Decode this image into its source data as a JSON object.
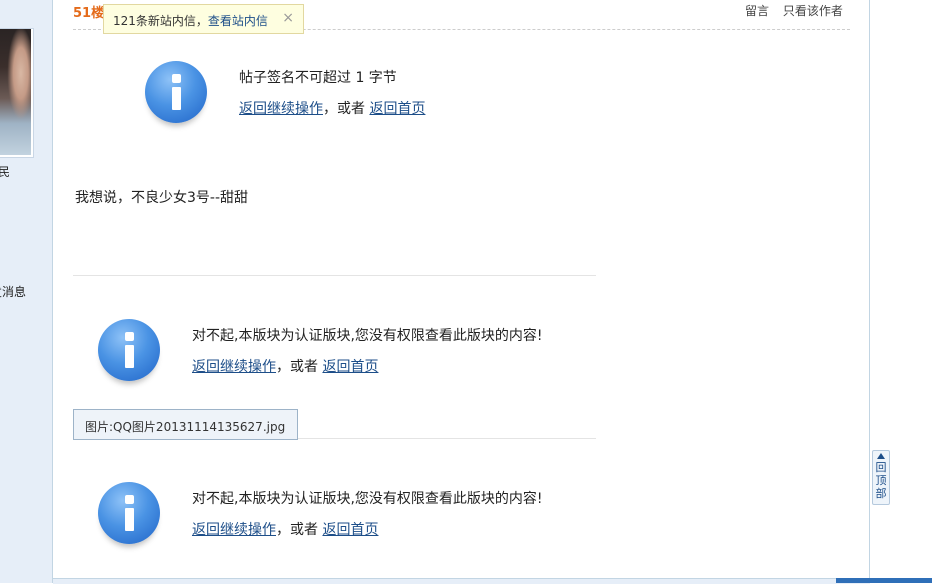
{
  "left": {
    "rank_fragment": "民",
    "msg_fragment": "发消息"
  },
  "post": {
    "floor": "51楼",
    "actions": [
      "留言",
      "只看该作者"
    ],
    "body_text": "我想说，不良少女3号--甜甜",
    "image_caption": "图片:QQ图片20131114135627.jpg"
  },
  "notify": {
    "count_text": "121条新站内信，",
    "link_text": "查看站内信",
    "close": "×"
  },
  "messages": [
    {
      "text": "帖子签名不可超过 1 字节",
      "back_link": "返回继续操作",
      "sep": "，或者 ",
      "home_link": "返回首页"
    },
    {
      "text": "对不起,本版块为认证版块,您没有权限查看此版块的内容!",
      "back_link": "返回继续操作",
      "sep": "，或者 ",
      "home_link": "返回首页"
    },
    {
      "text": "对不起,本版块为认证版块,您没有权限查看此版块的内容!",
      "back_link": "返回继续操作",
      "sep": "，或者 ",
      "home_link": "返回首页"
    }
  ],
  "totop": {
    "chars": [
      "回",
      "顶",
      "部"
    ]
  },
  "colors": {
    "accent": "#1d4e89",
    "floor": "#e46b1b",
    "notify_bg": "#fefee0",
    "info_icon": "#3b82e0"
  }
}
